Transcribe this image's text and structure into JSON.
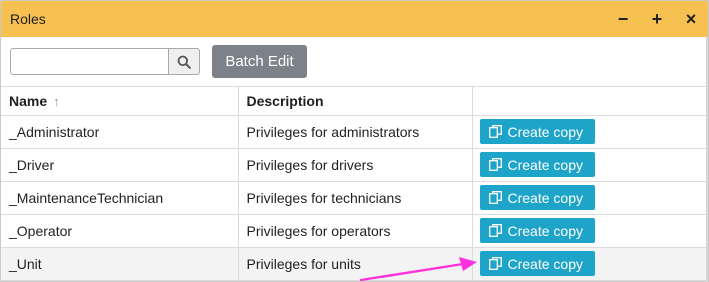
{
  "window": {
    "title": "Roles",
    "controls": {
      "minimize": "−",
      "maximize": "+",
      "close": "×"
    }
  },
  "toolbar": {
    "search_value": "",
    "search_placeholder": "",
    "search_icon": "search-icon",
    "batch_edit_label": "Batch Edit"
  },
  "table": {
    "columns": [
      {
        "label": "Name",
        "sort": "ascending"
      },
      {
        "label": "Description"
      },
      {
        "label": ""
      }
    ],
    "rows": [
      {
        "name": "_Administrator",
        "description": "Privileges for administrators",
        "action": "Create copy"
      },
      {
        "name": "_Driver",
        "description": "Privileges for drivers",
        "action": "Create copy"
      },
      {
        "name": "_MaintenanceTechnician",
        "description": "Privileges for technicians",
        "action": "Create copy"
      },
      {
        "name": "_Operator",
        "description": "Privileges for operators",
        "action": "Create copy"
      },
      {
        "name": "_Unit",
        "description": "Privileges for units",
        "action": "Create copy"
      }
    ]
  },
  "colors": {
    "titlebar": "#f6c150",
    "batch_button": "#7c8287",
    "copy_button": "#1ea4c9",
    "annotation_arrow": "#ff33dd"
  }
}
